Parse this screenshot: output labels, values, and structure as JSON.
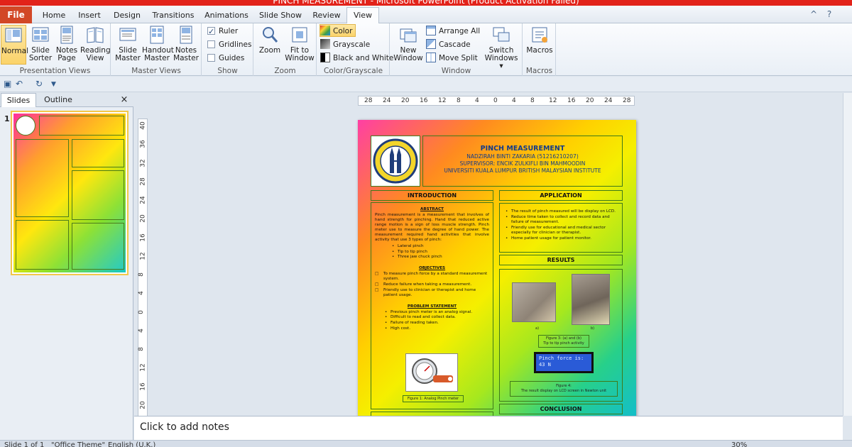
{
  "window": {
    "title": "PINCH MEASUREMENT - Microsoft PowerPoint (Product Activation Failed)"
  },
  "tabs": {
    "file": "File",
    "items": [
      "Home",
      "Insert",
      "Design",
      "Transitions",
      "Animations",
      "Slide Show",
      "Review",
      "View"
    ],
    "active": "View"
  },
  "ribbon": {
    "presentation_views": {
      "label": "Presentation Views",
      "normal": "Normal",
      "slide_sorter_1": "Slide",
      "slide_sorter_2": "Sorter",
      "notes_page_1": "Notes",
      "notes_page_2": "Page",
      "reading_view_1": "Reading",
      "reading_view_2": "View"
    },
    "master_views": {
      "label": "Master Views",
      "slide_master_1": "Slide",
      "slide_master_2": "Master",
      "handout_master_1": "Handout",
      "handout_master_2": "Master",
      "notes_master_1": "Notes",
      "notes_master_2": "Master"
    },
    "show": {
      "label": "Show",
      "ruler": "Ruler",
      "gridlines": "Gridlines",
      "guides": "Guides"
    },
    "zoom": {
      "label": "Zoom",
      "zoom": "Zoom",
      "fit_1": "Fit to",
      "fit_2": "Window"
    },
    "color_grayscale": {
      "label": "Color/Grayscale",
      "color": "Color",
      "grayscale": "Grayscale",
      "bw": "Black and White"
    },
    "window": {
      "label": "Window",
      "new_window_1": "New",
      "new_window_2": "Window",
      "arrange_all": "Arrange All",
      "cascade": "Cascade",
      "move_split": "Move Split",
      "switch_1": "Switch",
      "switch_2": "Windows"
    },
    "macros": {
      "label": "Macros",
      "macros": "Macros"
    }
  },
  "left_pane": {
    "tabs": [
      "Slides",
      "Outline"
    ],
    "slide_number": "1"
  },
  "ruler": {
    "h_ticks": [
      "28",
      "24",
      "20",
      "16",
      "12",
      "8",
      "4",
      "0",
      "4",
      "8",
      "12",
      "16",
      "20",
      "24",
      "28"
    ],
    "v_ticks": [
      "40",
      "36",
      "32",
      "28",
      "24",
      "20",
      "16",
      "12",
      "8",
      "4",
      "0",
      "4",
      "8",
      "12",
      "16",
      "20"
    ]
  },
  "poster": {
    "title": "PINCH MEASUREMENT",
    "author": "NADZIRAH BINTI ZAKARIA (51216210207)",
    "supervisor": "SUPERVISOR: ENCIK ZULKIFLI BIN MAHMOODIN",
    "institute": "UNIVERSITI KUALA LUMPUR BRITISH MALAYSIAN INSTITUTE",
    "introduction": {
      "header": "INTRODUCTION",
      "abstract_title": "ABSTRACT",
      "abstract": "Pinch measurement is a measurement that involves of hand strength for pinching. Hand that reduced active range motion is a sign of loss muscle strength. Pinch meter use to measure the degree of hand power. The measurement required hand activities that involve activity that use 3 types of pinch:",
      "pinch_types": [
        "Lateral pinch",
        "Tip to tip pinch",
        "Three jaw chuck pinch"
      ],
      "objectives_title": "OBJECTIVES",
      "objectives": [
        "To measure pinch force by a standard measurement system.",
        "Reduce failure when taking a measurement.",
        "Friendly use to clinician or therapist and home patient usage."
      ],
      "problem_title": "PROBLEM STATEMENT",
      "problems": [
        "Previous pinch meter is an analog signal.",
        "Difficult to read and collect data.",
        "Failure of reading taken.",
        "High cost."
      ],
      "figure1": "Figure 1: Analog Pinch meter"
    },
    "application": {
      "header": "APPLICATION",
      "items": [
        "The result of pinch measured will be display on LCD.",
        "Reduce time taken to collect and record data and failure of measurement.",
        "Friendly use for educational and medical sector especially for clinician or therapist.",
        "Home patient usage for patient monitor."
      ]
    },
    "results": {
      "header": "RESULTS",
      "label_a": "a)",
      "label_b": "b)",
      "figure3_1": "Figure 3: (a) and (b)",
      "figure3_2": "Tip to tip pinch activity",
      "lcd_1": "Pinch force is:",
      "lcd_2": "43 N",
      "figure4_1": "Figure 4:",
      "figure4_2": "The result display on LCD screen in Newton unit"
    },
    "conclusion": {
      "header": "CONCLUSION"
    }
  },
  "notes": {
    "placeholder": "Click to add notes"
  },
  "statusbar": {
    "slide": "Slide 1 of 1",
    "theme": "\"Office Theme\"",
    "language": "English (U.K.)",
    "zoom": "30%"
  }
}
